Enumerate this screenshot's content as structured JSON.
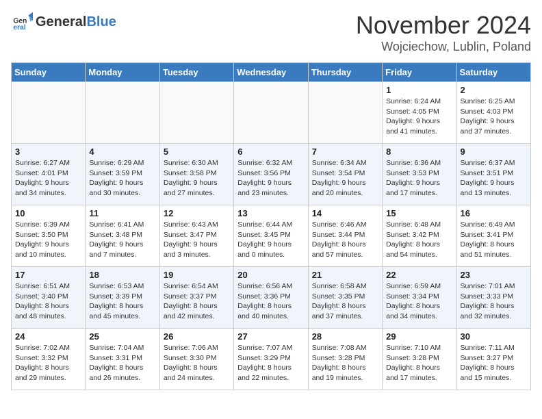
{
  "header": {
    "title": "November 2024",
    "location": "Wojciechow, Lublin, Poland",
    "logo_general": "General",
    "logo_blue": "Blue"
  },
  "weekdays": [
    "Sunday",
    "Monday",
    "Tuesday",
    "Wednesday",
    "Thursday",
    "Friday",
    "Saturday"
  ],
  "weeks": [
    [
      {
        "day": "",
        "info": ""
      },
      {
        "day": "",
        "info": ""
      },
      {
        "day": "",
        "info": ""
      },
      {
        "day": "",
        "info": ""
      },
      {
        "day": "",
        "info": ""
      },
      {
        "day": "1",
        "info": "Sunrise: 6:24 AM\nSunset: 4:05 PM\nDaylight: 9 hours and 41 minutes."
      },
      {
        "day": "2",
        "info": "Sunrise: 6:25 AM\nSunset: 4:03 PM\nDaylight: 9 hours and 37 minutes."
      }
    ],
    [
      {
        "day": "3",
        "info": "Sunrise: 6:27 AM\nSunset: 4:01 PM\nDaylight: 9 hours and 34 minutes."
      },
      {
        "day": "4",
        "info": "Sunrise: 6:29 AM\nSunset: 3:59 PM\nDaylight: 9 hours and 30 minutes."
      },
      {
        "day": "5",
        "info": "Sunrise: 6:30 AM\nSunset: 3:58 PM\nDaylight: 9 hours and 27 minutes."
      },
      {
        "day": "6",
        "info": "Sunrise: 6:32 AM\nSunset: 3:56 PM\nDaylight: 9 hours and 23 minutes."
      },
      {
        "day": "7",
        "info": "Sunrise: 6:34 AM\nSunset: 3:54 PM\nDaylight: 9 hours and 20 minutes."
      },
      {
        "day": "8",
        "info": "Sunrise: 6:36 AM\nSunset: 3:53 PM\nDaylight: 9 hours and 17 minutes."
      },
      {
        "day": "9",
        "info": "Sunrise: 6:37 AM\nSunset: 3:51 PM\nDaylight: 9 hours and 13 minutes."
      }
    ],
    [
      {
        "day": "10",
        "info": "Sunrise: 6:39 AM\nSunset: 3:50 PM\nDaylight: 9 hours and 10 minutes."
      },
      {
        "day": "11",
        "info": "Sunrise: 6:41 AM\nSunset: 3:48 PM\nDaylight: 9 hours and 7 minutes."
      },
      {
        "day": "12",
        "info": "Sunrise: 6:43 AM\nSunset: 3:47 PM\nDaylight: 9 hours and 3 minutes."
      },
      {
        "day": "13",
        "info": "Sunrise: 6:44 AM\nSunset: 3:45 PM\nDaylight: 9 hours and 0 minutes."
      },
      {
        "day": "14",
        "info": "Sunrise: 6:46 AM\nSunset: 3:44 PM\nDaylight: 8 hours and 57 minutes."
      },
      {
        "day": "15",
        "info": "Sunrise: 6:48 AM\nSunset: 3:42 PM\nDaylight: 8 hours and 54 minutes."
      },
      {
        "day": "16",
        "info": "Sunrise: 6:49 AM\nSunset: 3:41 PM\nDaylight: 8 hours and 51 minutes."
      }
    ],
    [
      {
        "day": "17",
        "info": "Sunrise: 6:51 AM\nSunset: 3:40 PM\nDaylight: 8 hours and 48 minutes."
      },
      {
        "day": "18",
        "info": "Sunrise: 6:53 AM\nSunset: 3:39 PM\nDaylight: 8 hours and 45 minutes."
      },
      {
        "day": "19",
        "info": "Sunrise: 6:54 AM\nSunset: 3:37 PM\nDaylight: 8 hours and 42 minutes."
      },
      {
        "day": "20",
        "info": "Sunrise: 6:56 AM\nSunset: 3:36 PM\nDaylight: 8 hours and 40 minutes."
      },
      {
        "day": "21",
        "info": "Sunrise: 6:58 AM\nSunset: 3:35 PM\nDaylight: 8 hours and 37 minutes."
      },
      {
        "day": "22",
        "info": "Sunrise: 6:59 AM\nSunset: 3:34 PM\nDaylight: 8 hours and 34 minutes."
      },
      {
        "day": "23",
        "info": "Sunrise: 7:01 AM\nSunset: 3:33 PM\nDaylight: 8 hours and 32 minutes."
      }
    ],
    [
      {
        "day": "24",
        "info": "Sunrise: 7:02 AM\nSunset: 3:32 PM\nDaylight: 8 hours and 29 minutes."
      },
      {
        "day": "25",
        "info": "Sunrise: 7:04 AM\nSunset: 3:31 PM\nDaylight: 8 hours and 26 minutes."
      },
      {
        "day": "26",
        "info": "Sunrise: 7:06 AM\nSunset: 3:30 PM\nDaylight: 8 hours and 24 minutes."
      },
      {
        "day": "27",
        "info": "Sunrise: 7:07 AM\nSunset: 3:29 PM\nDaylight: 8 hours and 22 minutes."
      },
      {
        "day": "28",
        "info": "Sunrise: 7:08 AM\nSunset: 3:28 PM\nDaylight: 8 hours and 19 minutes."
      },
      {
        "day": "29",
        "info": "Sunrise: 7:10 AM\nSunset: 3:28 PM\nDaylight: 8 hours and 17 minutes."
      },
      {
        "day": "30",
        "info": "Sunrise: 7:11 AM\nSunset: 3:27 PM\nDaylight: 8 hours and 15 minutes."
      }
    ]
  ]
}
